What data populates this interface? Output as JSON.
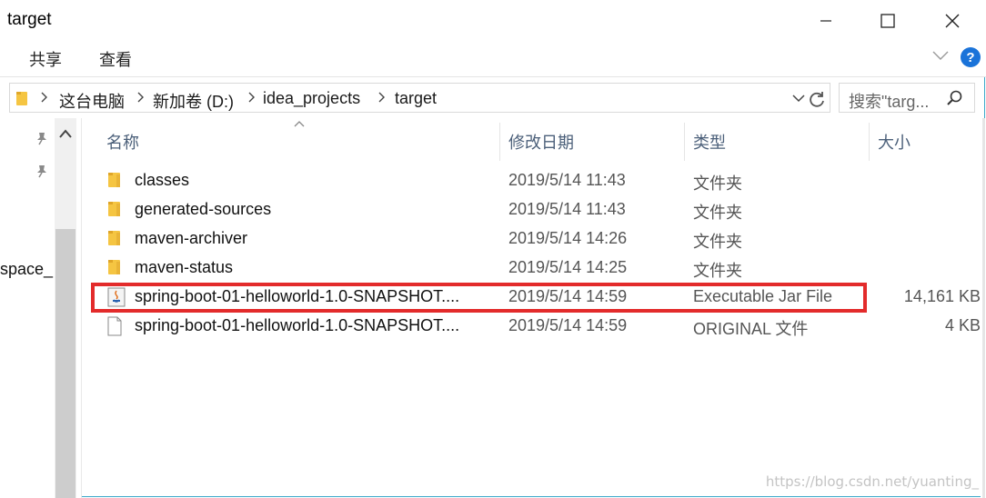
{
  "window": {
    "title": "target"
  },
  "ribbon": {
    "tabs": [
      "共享",
      "查看"
    ],
    "help": "?"
  },
  "address": {
    "crumbs": [
      "这台电脑",
      "新加卷 (D:)",
      "idea_projects",
      "target"
    ]
  },
  "search": {
    "placeholder": "搜索\"targ..."
  },
  "nav": {
    "item_partial": "space_"
  },
  "columns": {
    "name": "名称",
    "date": "修改日期",
    "type": "类型",
    "size": "大小"
  },
  "files": [
    {
      "name": "classes",
      "date": "2019/5/14 11:43",
      "type": "文件夹",
      "size": "",
      "icon": "folder-icon"
    },
    {
      "name": "generated-sources",
      "date": "2019/5/14 11:43",
      "type": "文件夹",
      "size": "",
      "icon": "folder-icon"
    },
    {
      "name": "maven-archiver",
      "date": "2019/5/14 14:26",
      "type": "文件夹",
      "size": "",
      "icon": "folder-icon"
    },
    {
      "name": "maven-status",
      "date": "2019/5/14 14:25",
      "type": "文件夹",
      "size": "",
      "icon": "folder-icon"
    },
    {
      "name": "spring-boot-01-helloworld-1.0-SNAPSHOT....",
      "date": "2019/5/14 14:59",
      "type": "Executable Jar File",
      "size": "14,161 KB",
      "icon": "java-jar-icon"
    },
    {
      "name": "spring-boot-01-helloworld-1.0-SNAPSHOT....",
      "date": "2019/5/14 14:59",
      "type": "ORIGINAL 文件",
      "size": "4 KB",
      "icon": "file-icon"
    }
  ],
  "watermark": "https://blog.csdn.net/yuanting_",
  "colors": {
    "folder": "#f5c542",
    "highlight": "#e32b2b",
    "header_text": "#4c607a",
    "help": "#1a73d9"
  }
}
